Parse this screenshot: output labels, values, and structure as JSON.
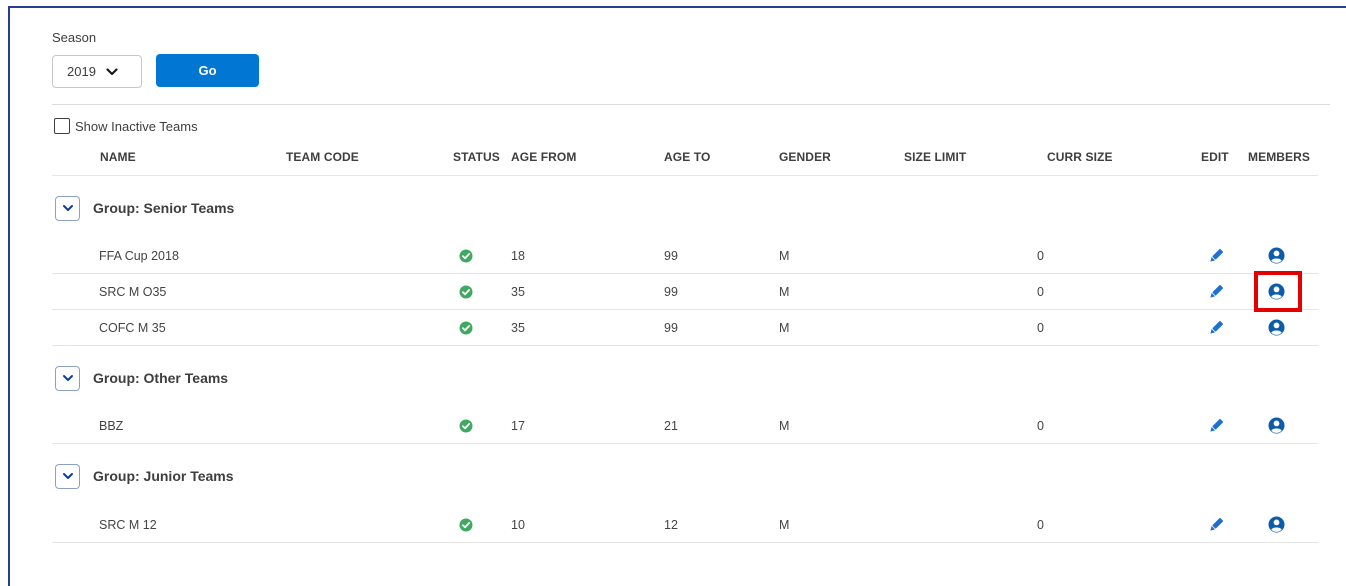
{
  "season": {
    "label": "Season",
    "selected": "2019",
    "go_label": "Go"
  },
  "show_inactive": {
    "label": "Show Inactive Teams",
    "checked": false
  },
  "columns": {
    "name": "NAME",
    "team_code": "TEAM CODE",
    "status": "STATUS",
    "age_from": "AGE FROM",
    "age_to": "AGE TO",
    "gender": "GENDER",
    "size_limit": "SIZE LIMIT",
    "curr_size": "CURR SIZE",
    "edit": "EDIT",
    "members": "MEMBERS"
  },
  "groups": [
    {
      "title": "Group: Senior Teams",
      "rows": [
        {
          "name": "FFA Cup 2018",
          "team_code": "",
          "status": "active",
          "age_from": "18",
          "age_to": "99",
          "gender": "M",
          "size_limit": "",
          "curr_size": "0"
        },
        {
          "name": "SRC M O35",
          "team_code": "",
          "status": "active",
          "age_from": "35",
          "age_to": "99",
          "gender": "M",
          "size_limit": "",
          "curr_size": "0"
        },
        {
          "name": "COFC M 35",
          "team_code": "",
          "status": "active",
          "age_from": "35",
          "age_to": "99",
          "gender": "M",
          "size_limit": "",
          "curr_size": "0"
        }
      ]
    },
    {
      "title": "Group: Other Teams",
      "rows": [
        {
          "name": "BBZ",
          "team_code": "",
          "status": "active",
          "age_from": "17",
          "age_to": "21",
          "gender": "M",
          "size_limit": "",
          "curr_size": "0"
        }
      ]
    },
    {
      "title": "Group: Junior Teams",
      "rows": [
        {
          "name": "SRC M 12",
          "team_code": "",
          "status": "active",
          "age_from": "10",
          "age_to": "12",
          "gender": "M",
          "size_limit": "",
          "curr_size": "0"
        }
      ]
    }
  ],
  "colors": {
    "accent": "#0176d3",
    "status_ok": "#4bca81",
    "icon_blue": "#0b5cab",
    "highlight": "#e50000",
    "frame": "#283e8f"
  },
  "icons": {
    "status": "check-circle-icon",
    "edit": "pencil-icon",
    "members": "user-circle-icon",
    "group_toggle": "chevron-down-icon"
  }
}
